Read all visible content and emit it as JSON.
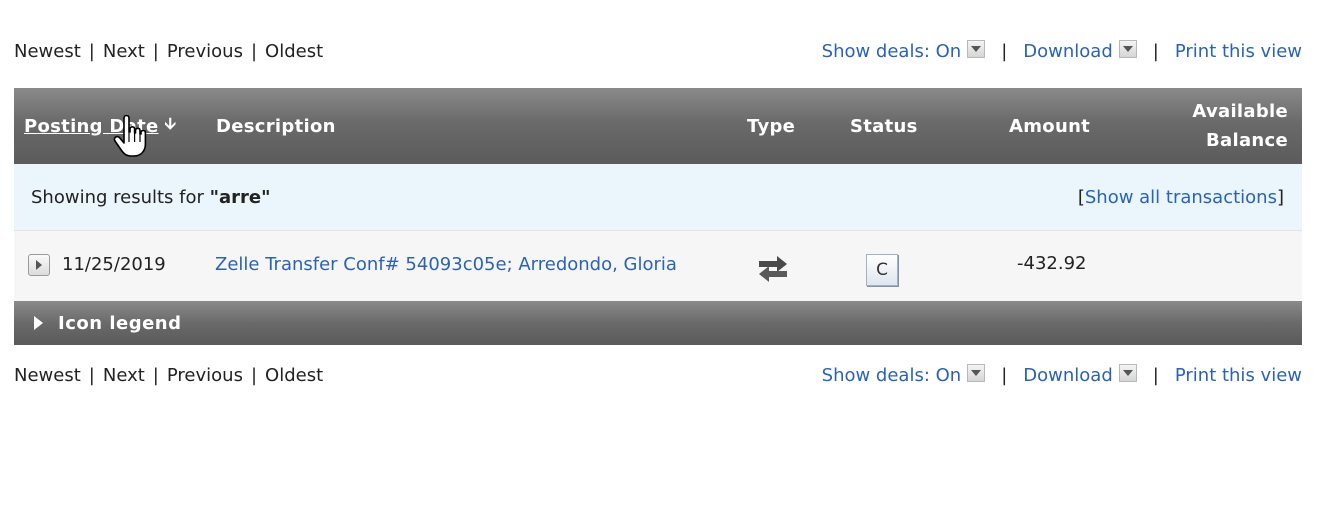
{
  "nav": {
    "newest": "Newest",
    "next": "Next",
    "previous": "Previous",
    "oldest": "Oldest",
    "separator": "|",
    "show_deals": "Show deals: On",
    "download": "Download",
    "print": "Print this view"
  },
  "table": {
    "headers": {
      "posting_date": "Posting Date",
      "description": "Description",
      "type": "Type",
      "status": "Status",
      "amount": "Amount",
      "available_line1": "Available",
      "available_line2": "Balance"
    },
    "filter": {
      "prefix": "Showing results for",
      "query": "\"arre\"",
      "open_bracket": "[",
      "show_all": "Show all transactions",
      "close_bracket": "]"
    },
    "rows": [
      {
        "date": "11/25/2019",
        "description": "Zelle Transfer Conf# 54093c05e; Arredondo, Gloria",
        "type_icon": "transfer-icon",
        "status": "C",
        "amount": "-432.92",
        "available_balance": ""
      }
    ],
    "icon_legend": "Icon legend"
  },
  "colors": {
    "link": "#2a63b5",
    "header_bg": "#6a6a6a",
    "filter_bg": "#eaf5fc"
  }
}
